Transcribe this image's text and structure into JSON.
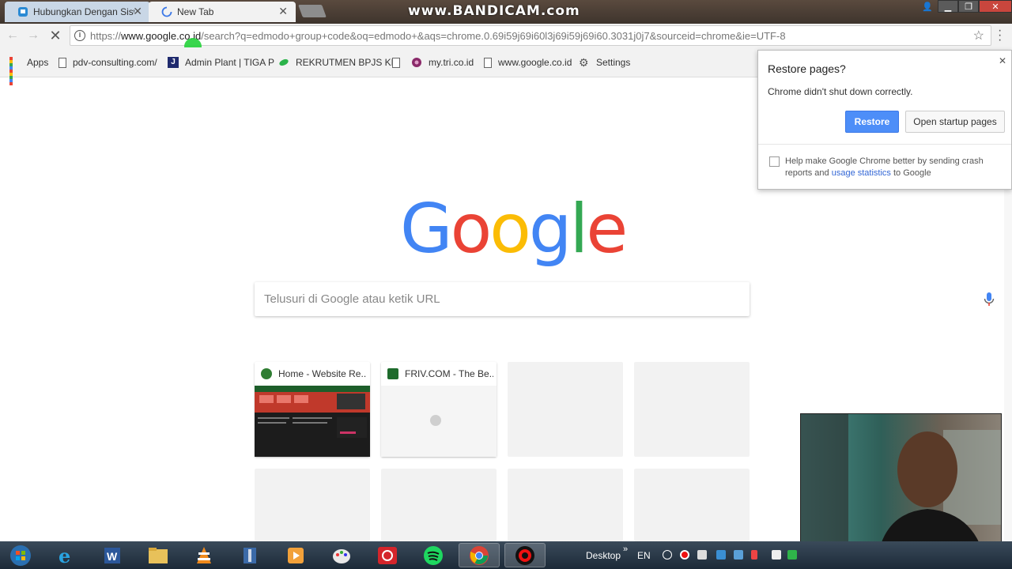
{
  "tabs": [
    {
      "label": "Hubungkan Dengan Sisw",
      "active": false
    },
    {
      "label": "New Tab",
      "active": true
    }
  ],
  "watermark": "www.BANDICAM.com",
  "omnibox": {
    "scheme": "https://",
    "host": "www.google.co.id",
    "path": "/search?q=edmodo+group+code&oq=edmodo+&aqs=chrome.0.69i59j69i60l3j69i59j69i60.3031j0j7&sourceid=chrome&ie=UTF-8"
  },
  "bookmarks": [
    {
      "label": "Apps",
      "icon": "apps-grid-icon"
    },
    {
      "label": "pdv-consulting.com/",
      "icon": "page-icon"
    },
    {
      "label": "Admin Plant | TIGA P",
      "icon": "j-logo-icon"
    },
    {
      "label": "REKRUTMEN BPJS KE",
      "icon": "bpjs-icon"
    },
    {
      "label": "my.tri.co.id",
      "icon": "tri-icon"
    },
    {
      "label": "www.google.co.id",
      "icon": "page-icon"
    },
    {
      "label": "Settings",
      "icon": "gear-icon"
    }
  ],
  "logo": {
    "letters": [
      "G",
      "o",
      "o",
      "g",
      "l",
      "e"
    ],
    "colors": [
      "#4285F4",
      "#EA4335",
      "#FBBC05",
      "#4285F4",
      "#34A853",
      "#EA4335"
    ]
  },
  "search": {
    "placeholder": "Telusuri di Google atau ketik URL"
  },
  "tiles": [
    {
      "title": "Home - Website Re...",
      "favicon_color": "#2f7d32"
    },
    {
      "title": "FRIV.COM - The Be...",
      "favicon_color": "#1e6b2c"
    }
  ],
  "restore_bubble": {
    "title": "Restore pages?",
    "message": "Chrome didn't shut down correctly.",
    "restore_label": "Restore",
    "startup_label": "Open startup pages",
    "help_text_1": "Help make Google Chrome better by sending crash reports and",
    "help_link": "usage statistics",
    "help_text_2": "to Google"
  },
  "taskbar": {
    "desktop_label": "Desktop",
    "lang": "EN",
    "apps": [
      "start-orb-icon",
      "internet-explorer-icon",
      "word-icon",
      "file-explorer-icon",
      "vlc-icon",
      "archive-icon",
      "media-player-icon",
      "paint-icon",
      "adobe-cc-icon",
      "spotify-icon",
      "chrome-icon",
      "bandicam-icon"
    ]
  },
  "colors": {
    "accent": "#4d8ef8",
    "toolbar": "#f2f2f2"
  }
}
